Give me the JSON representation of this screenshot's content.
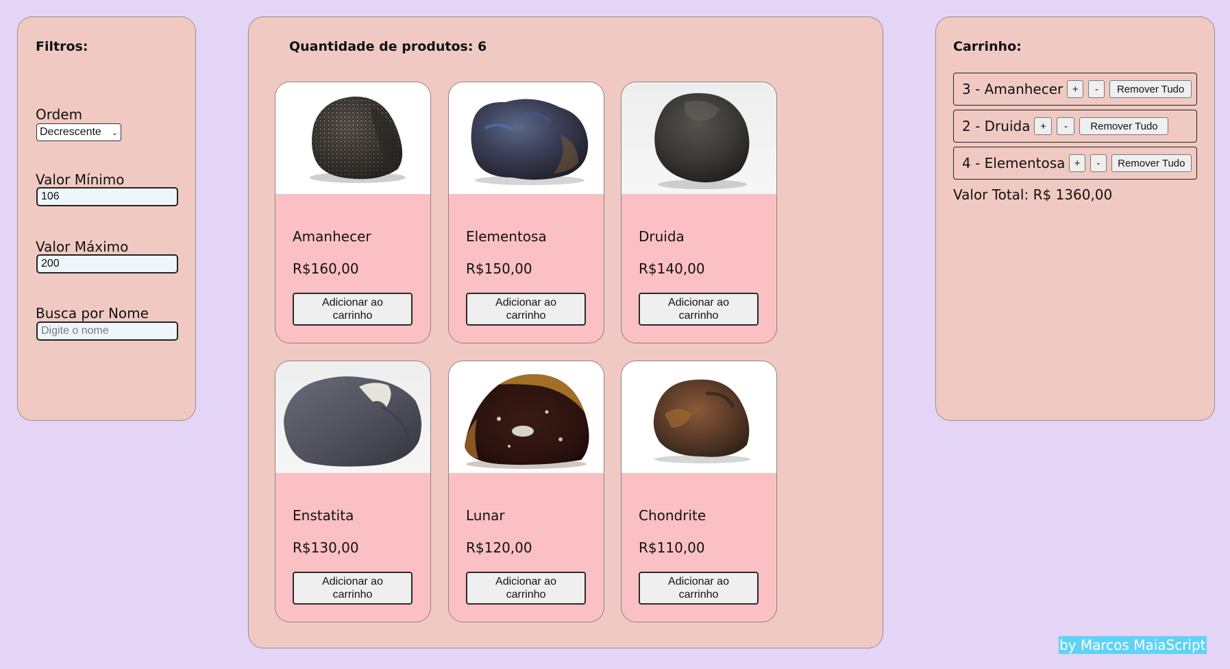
{
  "filters": {
    "title": "Filtros:",
    "order_label": "Ordem",
    "order_selected": "Decrescente",
    "min_label": "Valor Mínimo",
    "min_value": "106",
    "max_label": "Valor Máximo",
    "max_value": "200",
    "search_label": "Busca por Nome",
    "search_placeholder": "Digite o nome"
  },
  "products": {
    "title": "Quantidade de produtos: 6",
    "items": [
      {
        "name": "Amanhecer",
        "price": "R$160,00",
        "button": "Adicionar ao carrinho",
        "image_icon": "meteorite-speckled-icon"
      },
      {
        "name": "Elementosa",
        "price": "R$150,00",
        "button": "Adicionar ao carrinho",
        "image_icon": "meteorite-blue-icon"
      },
      {
        "name": "Druida",
        "price": "R$140,00",
        "button": "Adicionar ao carrinho",
        "image_icon": "meteorite-dark-icon"
      },
      {
        "name": "Enstatita",
        "price": "R$130,00",
        "button": "Adicionar ao carrinho",
        "image_icon": "meteorite-grey-icon"
      },
      {
        "name": "Lunar",
        "price": "R$120,00",
        "button": "Adicionar ao carrinho",
        "image_icon": "meteorite-brown-icon"
      },
      {
        "name": "Chondrite",
        "price": "R$110,00",
        "button": "Adicionar ao carrinho",
        "image_icon": "meteorite-rust-icon"
      }
    ]
  },
  "cart": {
    "title": "Carrinho:",
    "items": [
      {
        "label": "3 - Amanhecer",
        "plus": "+",
        "minus": "-",
        "remove": "Remover Tudo"
      },
      {
        "label": "2 - Druida",
        "plus": "+",
        "minus": "-",
        "remove": "Remover Tudo"
      },
      {
        "label": "4 - Elementosa",
        "plus": "+",
        "minus": "-",
        "remove": "Remover Tudo"
      }
    ],
    "total": "Valor Total: R$ 1360,00"
  },
  "footer": {
    "credit": "by Marcos MaiaScript"
  },
  "colors": {
    "background": "#e4d5f7",
    "panel": "#f0cac2",
    "card": "#fbc0c4",
    "credit_bg": "#5fd3f5"
  }
}
